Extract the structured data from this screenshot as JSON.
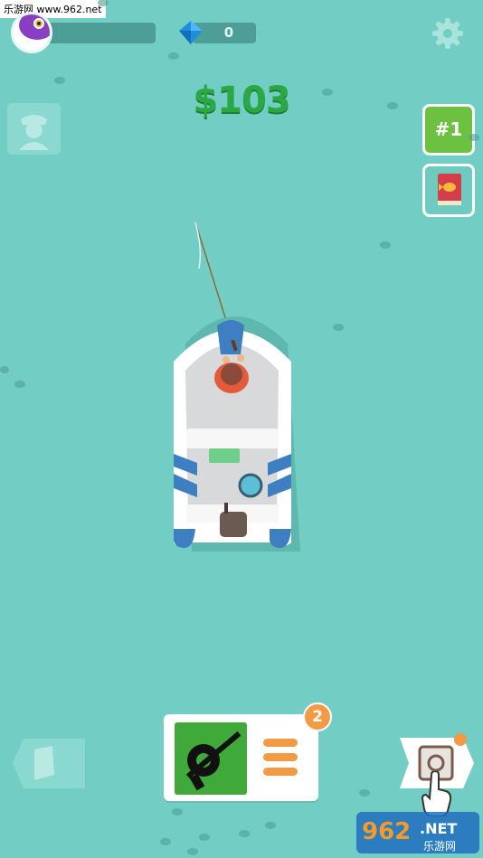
{
  "watermark_top": "乐游网 www.962.net",
  "player": {
    "avatar_icon": "purple-fish-avatar",
    "progress": 0
  },
  "currency": {
    "gems": "0",
    "gem_icon": "diamond-icon",
    "money": "$103"
  },
  "rank": {
    "label": "#1"
  },
  "upgrade_card": {
    "badge_count": "2",
    "item_icon": "fishing-rod-reel-icon",
    "menu_icon": "menu-lines-icon"
  },
  "icons": {
    "settings": "gear-icon",
    "captain": "captain-icon",
    "fish_book": "fish-book-icon",
    "left_nav": "map-icon",
    "right_nav": "safe-icon",
    "tap_hint": "hand-pointer-icon"
  },
  "watermark_bottom": {
    "brand": "962",
    "suffix": ".NET",
    "sub": "乐游网"
  },
  "colors": {
    "water": "#72cec4",
    "money": "#2aa843",
    "rank_bg": "#6cc240",
    "accent_orange": "#f39a45",
    "card_green": "#3faa3a",
    "boat_blue": "#3d7fc0"
  }
}
